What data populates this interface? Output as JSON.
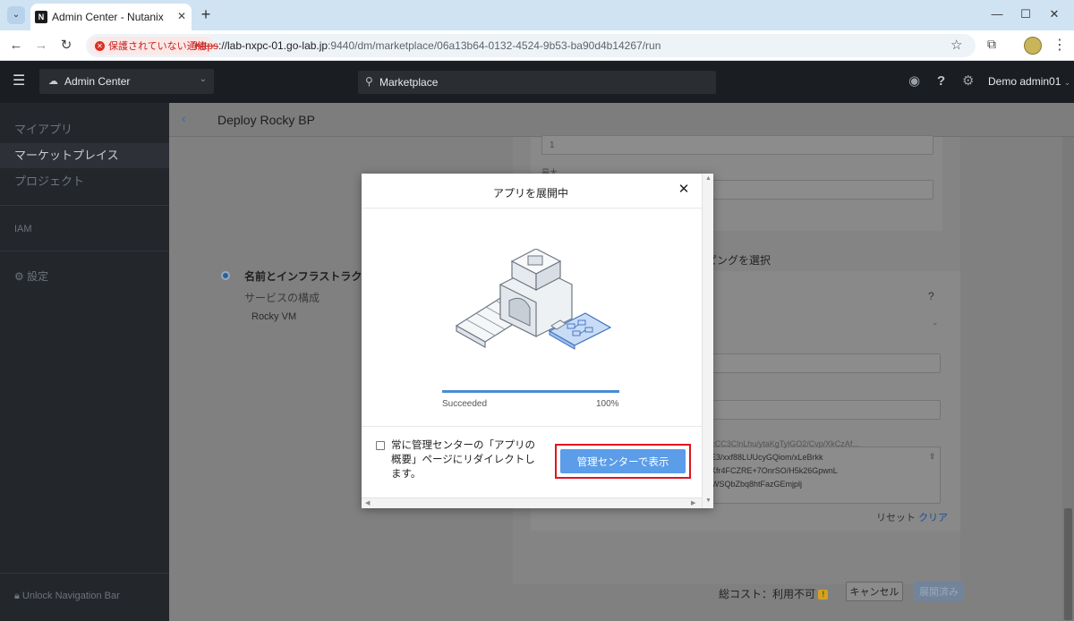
{
  "browser": {
    "tab_title": "Admin Center - Nutanix",
    "security_label": "保護されていない通信",
    "url_scheme": "https",
    "url_host": "://lab-nxpc-01.go-lab.jp",
    "url_rest": ":9440/dm/marketplace/06a13b64-0132-4524-9b53-ba90d4b14267/run"
  },
  "header": {
    "app_switcher": "Admin Center",
    "search_value": "Marketplace",
    "user": "Demo admin01"
  },
  "sidebar": {
    "items": [
      {
        "label": "マイアプリ"
      },
      {
        "label": "マーケットプレイス"
      },
      {
        "label": "プロジェクト"
      }
    ],
    "iam": "IAM",
    "settings": "設定",
    "unlock": "Unlock Navigation Bar"
  },
  "main": {
    "title": "Deploy Rocky BP",
    "field_value_1": "1",
    "field_label_2": "最大",
    "steps": [
      "名前とインフラストラクチ",
      "サービスの構成",
      "Rocky VM"
    ],
    "card_title": "ピングを選択",
    "help": "?",
    "ssh_lines": [
      "+cCC3ClnLhu/ytaKgTylGO2/Cvp/XkCzAf...",
      "3E3/xxf88LUUcyGQiom/xLeBrkk",
      "5Kfr4FCZRE+7OnrSO/H5k26GpwnL",
      "EWSQbZbq8htFazGEmjplj"
    ],
    "reset": "リセット",
    "clear": "クリア",
    "cost_label": "総コスト：利用不可",
    "cancel": "キャンセル",
    "deploy": "展開済み"
  },
  "modal": {
    "title": "アプリを展開中",
    "status": "Succeeded",
    "percent": "100%",
    "progress": 1.0,
    "redirect_label": "常に管理センターの「アプリの概要」ページにリダイレクトします。",
    "primary_button": "管理センターで表示"
  },
  "colors": {
    "accent": "#5b9de8",
    "highlight": "#e0141e",
    "progress": "#4a8bd6"
  }
}
